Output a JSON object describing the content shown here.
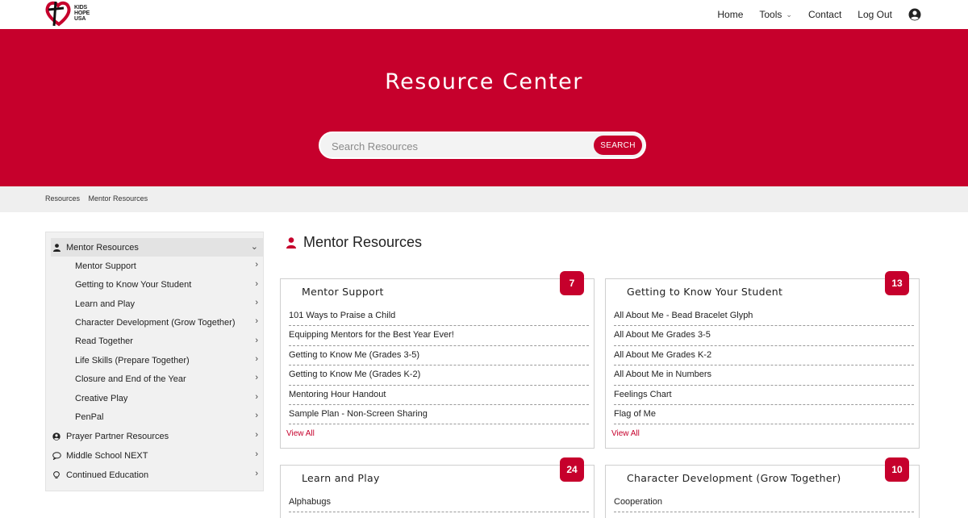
{
  "brand": {
    "logo_text": [
      "KIDS",
      "HOPE",
      "USA"
    ],
    "accent_color": "#c6002c"
  },
  "nav": {
    "items": [
      {
        "label": "Home"
      },
      {
        "label": "Tools",
        "has_dropdown": true
      },
      {
        "label": "Contact"
      },
      {
        "label": "Log Out"
      }
    ],
    "user_icon": "user-circle-icon"
  },
  "hero": {
    "title": "Resource Center",
    "search": {
      "placeholder": "Search Resources",
      "value": "",
      "button_label": "SEARCH"
    }
  },
  "breadcrumb": [
    "Resources",
    "Mentor Resources"
  ],
  "sidebar": {
    "items": [
      {
        "label": "Mentor Resources",
        "icon": "user-icon",
        "expanded": true,
        "active": true
      },
      {
        "label": "Mentor Support",
        "sub": true
      },
      {
        "label": "Getting to Know Your Student",
        "sub": true
      },
      {
        "label": "Learn and Play",
        "sub": true
      },
      {
        "label": "Character Development (Grow Together)",
        "sub": true
      },
      {
        "label": "Read Together",
        "sub": true
      },
      {
        "label": "Life Skills (Prepare Together)",
        "sub": true
      },
      {
        "label": "Closure and End of the Year",
        "sub": true
      },
      {
        "label": "Creative Play",
        "sub": true
      },
      {
        "label": "PenPal",
        "sub": true
      },
      {
        "label": "Prayer Partner Resources",
        "icon": "user-circle-icon"
      },
      {
        "label": "Middle School NEXT",
        "icon": "speech-bubble-icon"
      },
      {
        "label": "Continued Education",
        "icon": "lightbulb-icon"
      }
    ]
  },
  "main": {
    "title": "Mentor Resources",
    "title_icon": "user-icon",
    "cards": [
      {
        "title": "Mentor Support",
        "count": "7",
        "items": [
          "101 Ways to Praise a Child",
          "Equipping Mentors for the Best Year Ever!",
          "Getting to Know Me (Grades 3-5)",
          "Getting to Know Me (Grades K-2)",
          "Mentoring Hour Handout",
          "Sample Plan - Non-Screen Sharing"
        ],
        "view_all": "View All"
      },
      {
        "title": "Getting to Know Your Student",
        "count": "13",
        "items": [
          "All About Me - Bead Bracelet Glyph",
          "All About Me Grades 3-5",
          "All About Me Grades K-2",
          "All About Me in Numbers",
          "Feelings Chart",
          "Flag of Me"
        ],
        "view_all": "View All"
      },
      {
        "title": "Learn and Play",
        "count": "24",
        "items": [
          "Alphabugs"
        ]
      },
      {
        "title": "Character Development (Grow Together)",
        "count": "10",
        "items": [
          "Cooperation"
        ]
      }
    ]
  }
}
